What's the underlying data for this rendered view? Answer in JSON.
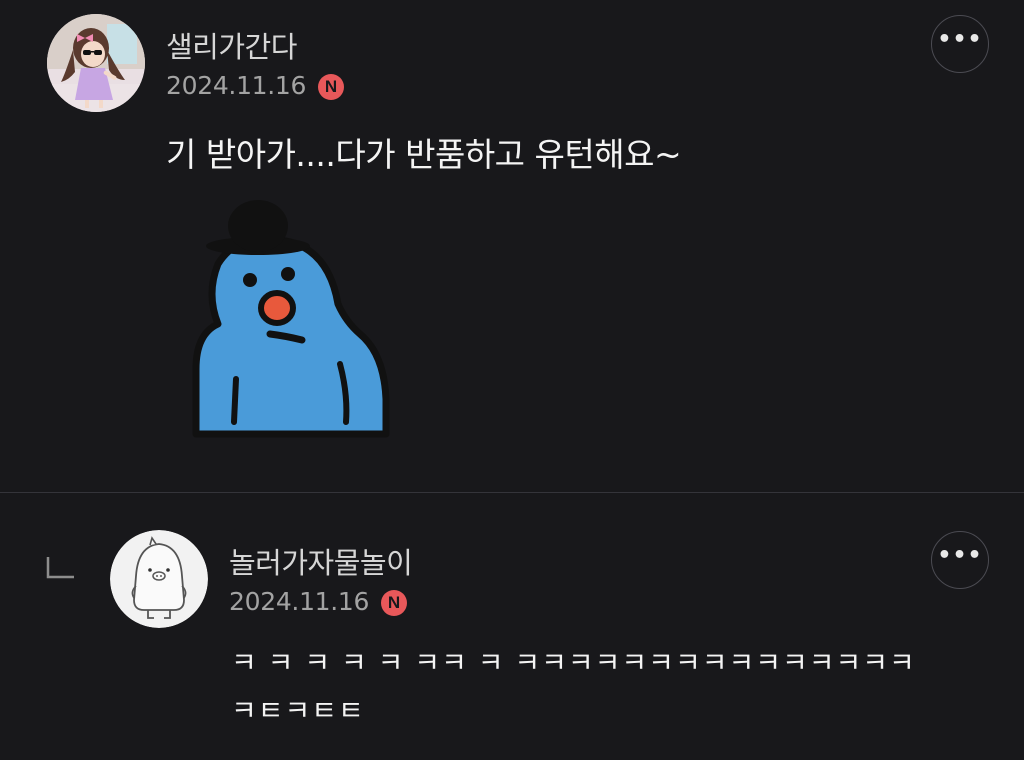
{
  "comments": [
    {
      "nickname": "샐리가간다",
      "date": "2024.11.16",
      "badge": "N",
      "text": "기 받아가....다가 반품하고 유턴해요~",
      "more": "•••",
      "avatar_icon": "profile-photo-girl",
      "sticker_icon": "blue-bird-with-bowler-hat-sticker"
    }
  ],
  "reply": {
    "nickname": "놀러가자물놀이",
    "date": "2024.11.16",
    "badge": "N",
    "text_line1": "ㅋ ㅋ ㅋ ㅋ ㅋ ㅋㅋ ㅋ ㅋㅋㅋㅋㅋㅋㅋㅋㅋㅋㅋㅋㅋㅋㅋ",
    "text_line2": "ㅋㅌㅋㅌㅌ",
    "more": "•••",
    "avatar_icon": "default-penguin-avatar",
    "reply_icon": "reply-arrow-icon"
  },
  "colors": {
    "background": "#18181b",
    "badge": "#e8585a",
    "sticker_blue": "#4a9bd9",
    "beak": "#e8593c"
  }
}
